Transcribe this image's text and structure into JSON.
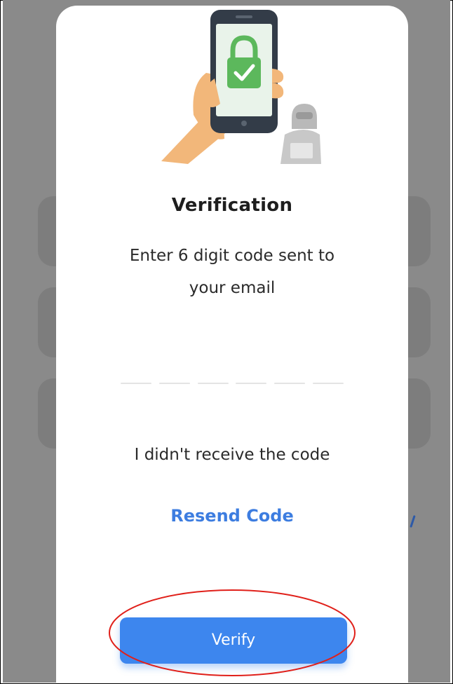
{
  "modal": {
    "title": "Verification",
    "subtitle_line1": "Enter 6 digit code sent to",
    "subtitle_line2": "your email",
    "code_slots": [
      "",
      "",
      "",
      "",
      "",
      ""
    ],
    "no_code_text": "I didn't receive the code",
    "resend_label": "Resend Code",
    "verify_label": "Verify"
  },
  "illustration": {
    "icon": "phone-lock-verification-illustration",
    "hacker_icon": "hacker-icon"
  },
  "annotation": {
    "icon": "red-circle-highlight"
  },
  "colors": {
    "accent": "#3d86ee",
    "link": "#3d7de0",
    "lock_green": "#5cb85c",
    "highlight_red": "#e0201a",
    "backdrop": "#8a8a8a"
  }
}
